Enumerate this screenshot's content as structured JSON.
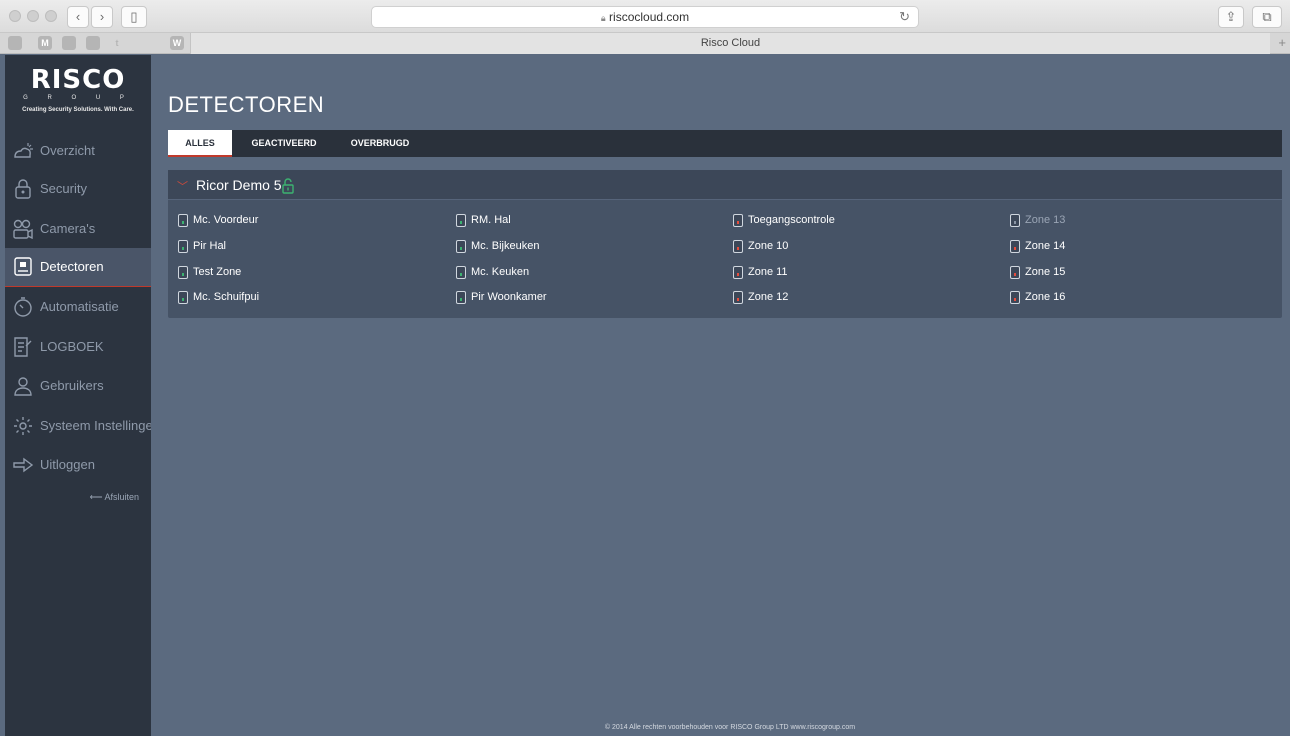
{
  "browser": {
    "url": "riscocloud.com",
    "tab_title": "Risco Cloud",
    "favicons": [
      "M",
      "W"
    ]
  },
  "brand": {
    "name": "RISCO",
    "group": "G R O U P",
    "tagline": "Creating Security Solutions. With Care."
  },
  "sidebar": {
    "items": [
      {
        "label": "Overzicht",
        "icon": "weather-icon"
      },
      {
        "label": "Security",
        "icon": "lock-icon"
      },
      {
        "label": "Camera's",
        "icon": "camera-icon"
      },
      {
        "label": "Detectoren",
        "icon": "detector-icon",
        "active": true
      },
      {
        "label": "Automatisatie",
        "icon": "timer-icon"
      },
      {
        "label": "LOGBOEK",
        "icon": "logbook-icon"
      },
      {
        "label": "Gebruikers",
        "icon": "user-icon"
      },
      {
        "label": "Systeem Instellingen",
        "icon": "gear-icon"
      },
      {
        "label": "Uitloggen",
        "icon": "logout-icon"
      }
    ],
    "close_label": "⟵ Afsluiten"
  },
  "page": {
    "title": "DETECTOREN",
    "tabs": [
      "ALLES",
      "GEACTIVEERD",
      "OVERBRUGD"
    ]
  },
  "partition": {
    "name": "Ricor Demo 5",
    "columns": [
      [
        "Mc. Voordeur",
        "Pir Hal",
        "Test Zone",
        "Mc. Schuifpui"
      ],
      [
        "RM. Hal",
        "Mc. Bijkeuken",
        "Mc. Keuken",
        "Pir Woonkamer"
      ],
      [
        "Toegangscontrole",
        "Zone 10",
        "Zone 11",
        "Zone 12"
      ],
      [
        "Zone 13",
        "Zone 14",
        "Zone 15",
        "Zone 16"
      ]
    ]
  },
  "colors": {
    "accent": "#c0392b",
    "ok": "#3cb371",
    "alarm": "#e74c3c",
    "sidebar_bg": "#2c3440",
    "content_bg": "#5b6a7f"
  },
  "footer": "© 2014 Alle rechten voorbehouden voor RISCO Group LTD  www.riscogroup.com"
}
